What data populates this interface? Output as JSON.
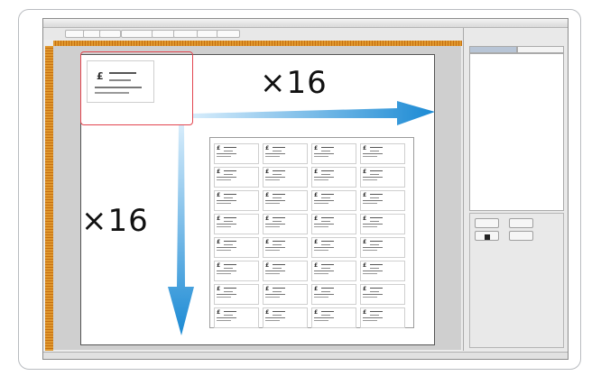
{
  "window": {
    "title": ""
  },
  "toolbar": {
    "buttons": [
      "",
      "",
      "",
      "",
      "",
      "",
      "",
      ""
    ]
  },
  "sidebar": {
    "tabs": [
      "",
      ""
    ],
    "items": [
      "",
      "",
      "",
      ""
    ],
    "buttons": [
      "",
      "",
      "",
      ""
    ]
  },
  "status_bar": {
    "text": ""
  },
  "annotations": {
    "horizontal_multiplier": "×16",
    "vertical_multiplier": "×16",
    "highlight_color": "#e2454f",
    "arrow_color": "#1d8fd6"
  },
  "card": {
    "logo_glyph": "£"
  },
  "grid": {
    "rows": 8,
    "cols": 4
  }
}
